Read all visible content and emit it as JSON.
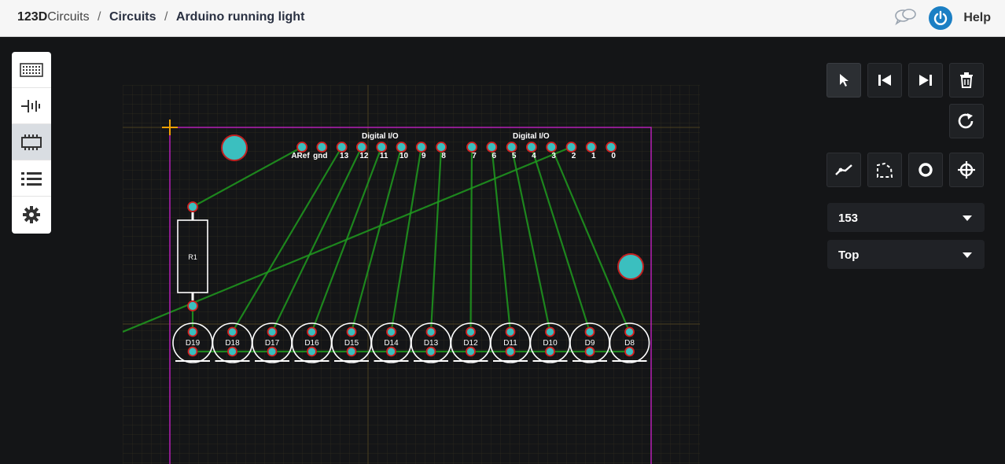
{
  "breadcrumb": {
    "brand_bold": "123D",
    "brand_light": "Circuits",
    "sep": "/",
    "section": "Circuits",
    "project": "Arduino running light"
  },
  "header": {
    "help_label": "Help"
  },
  "left_toolbar": [
    {
      "name": "breadboard-view",
      "icon": "breadboard-icon"
    },
    {
      "name": "schematic-view",
      "icon": "schematic-icon"
    },
    {
      "name": "pcb-view",
      "icon": "chip-icon",
      "active": true
    },
    {
      "name": "components-list",
      "icon": "list-icon"
    },
    {
      "name": "settings",
      "icon": "gear-icon"
    }
  ],
  "right_toolbar": {
    "tools": [
      "select-tool",
      "previous",
      "next",
      "delete",
      "rotate",
      "route-trace",
      "draw-board-outline",
      "via",
      "drill-hole"
    ]
  },
  "zoom_select": {
    "value": "153"
  },
  "layer_select": {
    "value": "Top"
  },
  "pcb": {
    "header_left_label": "Digital I/O",
    "header_right_label": "Digital I/O",
    "pins_left": [
      "ARef",
      "gnd",
      "13",
      "12",
      "11",
      "10",
      "9",
      "8"
    ],
    "pins_right": [
      "7",
      "6",
      "5",
      "4",
      "3",
      "2",
      "1",
      "0"
    ],
    "resistor_label": "R1",
    "leds": [
      "D19",
      "D18",
      "D17",
      "D16",
      "D15",
      "D14",
      "D13",
      "D12",
      "D11",
      "D10",
      "D9",
      "D8"
    ],
    "colors": {
      "background": "#141517",
      "grid": "#3a3420",
      "board_outline": "#c020c0",
      "trace": "#1f9a1f",
      "pad": "#3bbfbf",
      "pad_ring": "#d42020",
      "silkscreen": "#ffffff",
      "origin": "#f0a000"
    }
  }
}
